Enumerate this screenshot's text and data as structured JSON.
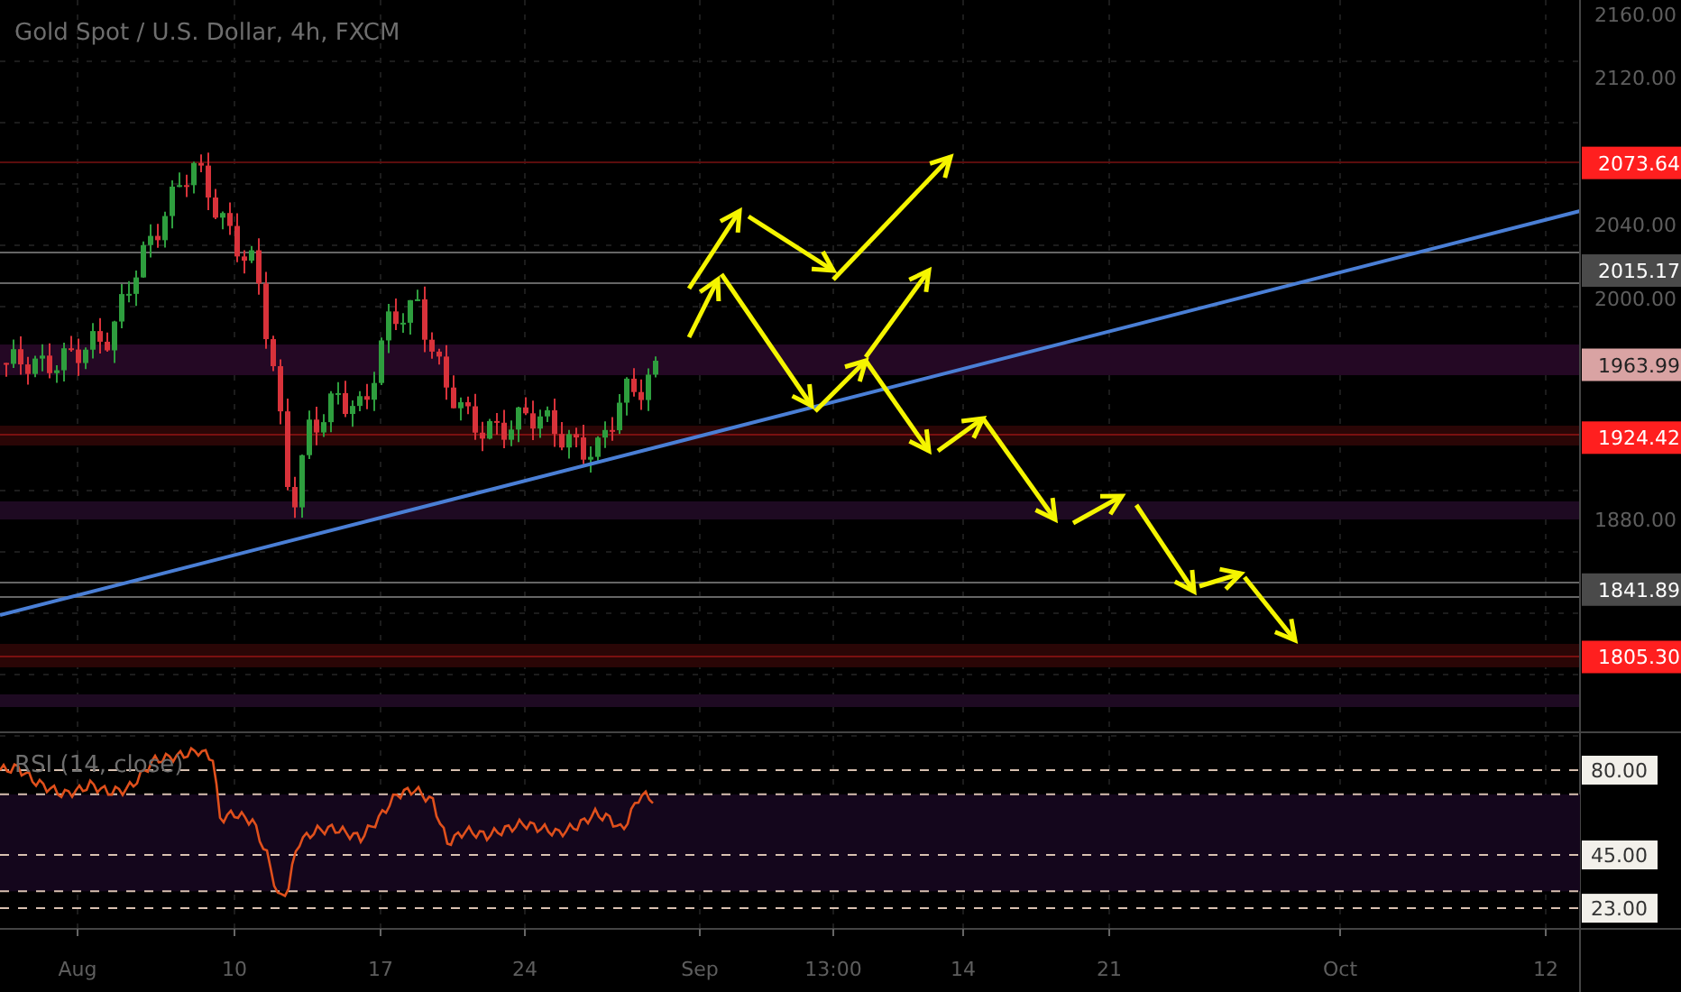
{
  "chart": {
    "title": "Gold Spot / U.S. Dollar, 4h, FXCM",
    "price_axis": {
      "ticks": [
        "2160.00",
        "2120.00",
        "2040.00",
        "2000.00",
        "1880.00"
      ]
    },
    "price_markers": [
      {
        "label": "2073.64",
        "color": "#ff1f1f"
      },
      {
        "label": "2015.17",
        "color": "#4a4a4a"
      },
      {
        "label": "1963.99",
        "color": "#d9a3a3"
      },
      {
        "label": "1924.42",
        "color": "#ff1f1f"
      },
      {
        "label": "1841.89",
        "color": "#4a4a4a"
      },
      {
        "label": "1805.30",
        "color": "#ff1f1f"
      }
    ]
  },
  "rsi": {
    "title": "RSI (14, close)",
    "markers": [
      "80.00",
      "45.00",
      "23.00"
    ]
  },
  "time_axis": {
    "labels": [
      "Aug",
      "10",
      "17",
      "24",
      "Sep",
      "13:00",
      "14",
      "21",
      "Oct",
      "12"
    ]
  }
}
